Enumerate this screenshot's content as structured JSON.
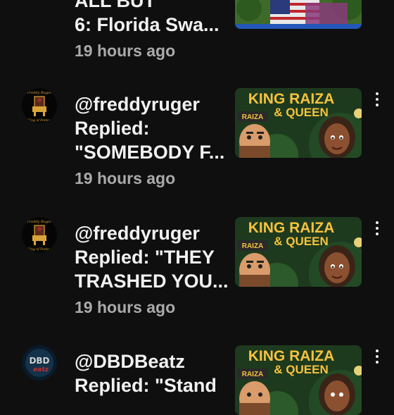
{
  "feed": {
    "items": [
      {
        "line1": "ALL BUT",
        "line2": "6: Florida Swa...",
        "time": "19 hours ago",
        "thumb_icon": "flag-crowd-thumbnail"
      },
      {
        "avatar_icon": "freddyruger-throne-avatar",
        "line1": "@freddyruger",
        "line2": "Replied:",
        "line3": "\"SOMEBODY F...",
        "time": "19 hours ago",
        "thumb_title_1": "KING RAIZA",
        "thumb_title_2": "& QUEEN",
        "thumb_badge": "RAIZA"
      },
      {
        "avatar_icon": "freddyruger-throne-avatar",
        "line1": "@freddyruger",
        "line2": "Replied: \"THEY",
        "line3": "TRASHED YOU...",
        "time": "19 hours ago",
        "thumb_title_1": "KING RAIZA",
        "thumb_title_2": "& QUEEN",
        "thumb_badge": "RAIZA"
      },
      {
        "avatar_icon": "dbdbeatz-logo-avatar",
        "line1": "@DBDBeatz",
        "line2": "Replied: \"Stand",
        "thumb_title_1": "KING RAIZA",
        "thumb_title_2": "& QUEEN",
        "thumb_badge": "RAIZA"
      }
    ]
  },
  "colors": {
    "background": "#0f0f0f",
    "primary_text": "#f1f1f1",
    "secondary_text": "#aaaaaa",
    "thumb_title": "#f6c23e"
  }
}
